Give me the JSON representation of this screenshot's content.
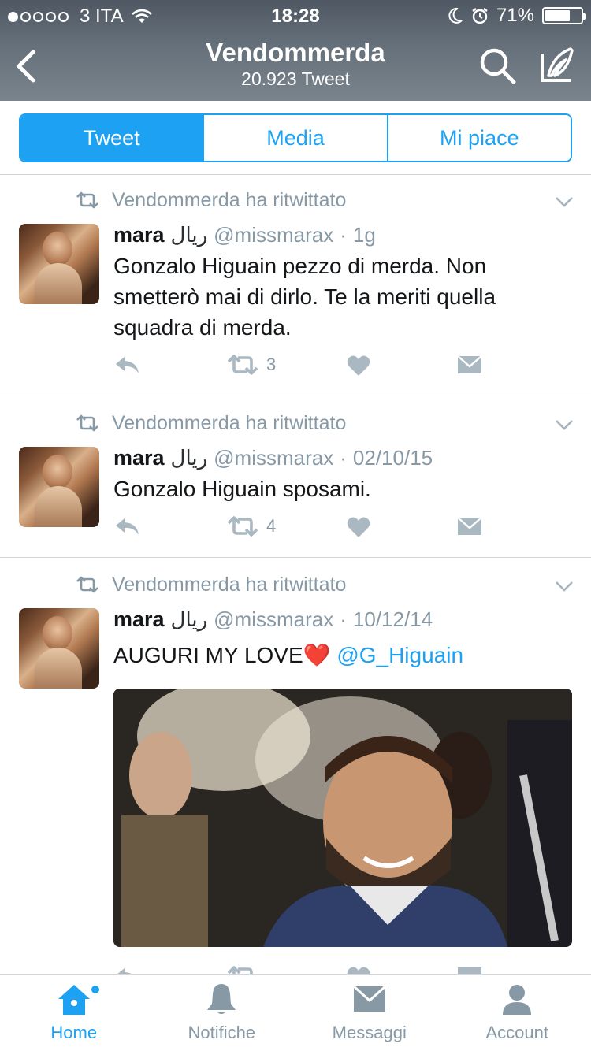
{
  "status_bar": {
    "carrier": "3 ITA",
    "time": "18:28",
    "battery": "71%",
    "battery_level": 0.71,
    "signal_bars_filled": 1,
    "signal_bars_total": 5
  },
  "nav": {
    "title": "Vendommerda",
    "subtitle": "20.923 Tweet"
  },
  "segments": [
    {
      "label": "Tweet",
      "active": true
    },
    {
      "label": "Media",
      "active": false
    },
    {
      "label": "Mi piace",
      "active": false
    }
  ],
  "tweets": [
    {
      "retweeted_by": "Vendommerda ha ritwittato",
      "name": "mara",
      "badge": "ريال",
      "handle": "@missmarax",
      "sep": "·",
      "date": "1g",
      "text": "Gonzalo Higuain pezzo di merda. Non smetterò mai di dirlo. Te la meriti quella squadra di merda.",
      "retweets": "3"
    },
    {
      "retweeted_by": "Vendommerda ha ritwittato",
      "name": "mara",
      "badge": "ريال",
      "handle": "@missmarax",
      "sep": "·",
      "date": "02/10/15",
      "text": "Gonzalo Higuain sposami.",
      "retweets": "4"
    },
    {
      "retweeted_by": "Vendommerda ha ritwittato",
      "name": "mara",
      "badge": "ريال",
      "handle": "@missmarax",
      "sep": "·",
      "date": "10/12/14",
      "text": "AUGURI MY LOVE",
      "emoji": "❤️",
      "mention": "@G_Higuain"
    }
  ],
  "tabbar": [
    {
      "label": "Home",
      "icon": "home-icon",
      "active": true
    },
    {
      "label": "Notifiche",
      "icon": "bell-icon",
      "active": false
    },
    {
      "label": "Messaggi",
      "icon": "envelope-icon",
      "active": false
    },
    {
      "label": "Account",
      "icon": "person-icon",
      "active": false
    }
  ],
  "colors": {
    "accent": "#1da1f2",
    "muted": "#8899a6",
    "text": "#14171a"
  }
}
